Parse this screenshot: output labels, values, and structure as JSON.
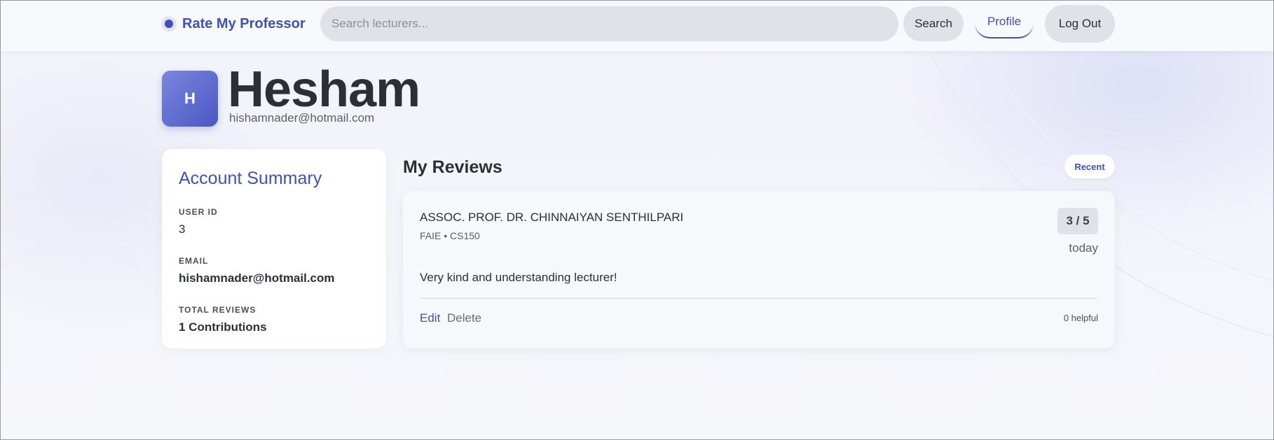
{
  "header": {
    "brand": "Rate My Professor",
    "search_placeholder": "Search lecturers...",
    "search_button": "Search",
    "profile_link": "Profile",
    "logout_button": "Log Out"
  },
  "profile": {
    "avatar_initial": "H",
    "name": "Hesham",
    "email": "hishamnader@hotmail.com"
  },
  "summary": {
    "title": "Account Summary",
    "fields": [
      {
        "label": "USER ID",
        "value": "3"
      },
      {
        "label": "EMAIL",
        "value": "hishamnader@hotmail.com"
      },
      {
        "label": "TOTAL REVIEWS",
        "value": "1 Contributions"
      }
    ]
  },
  "reviews": {
    "title": "My Reviews",
    "sort_label": "Recent",
    "items": [
      {
        "lecturer": "ASSOC. PROF. DR. CHINNAIYAN SENTHILPARI",
        "meta": "FAIE • CS150",
        "score": "3 / 5",
        "date": "today",
        "text": "Very kind and understanding lecturer!",
        "edit_label": "Edit",
        "delete_label": "Delete",
        "helpful": "0 helpful"
      }
    ]
  },
  "colors": {
    "accent": "#3f51b5",
    "background": "#f5f6fb",
    "chip": "#dfe3e7"
  }
}
